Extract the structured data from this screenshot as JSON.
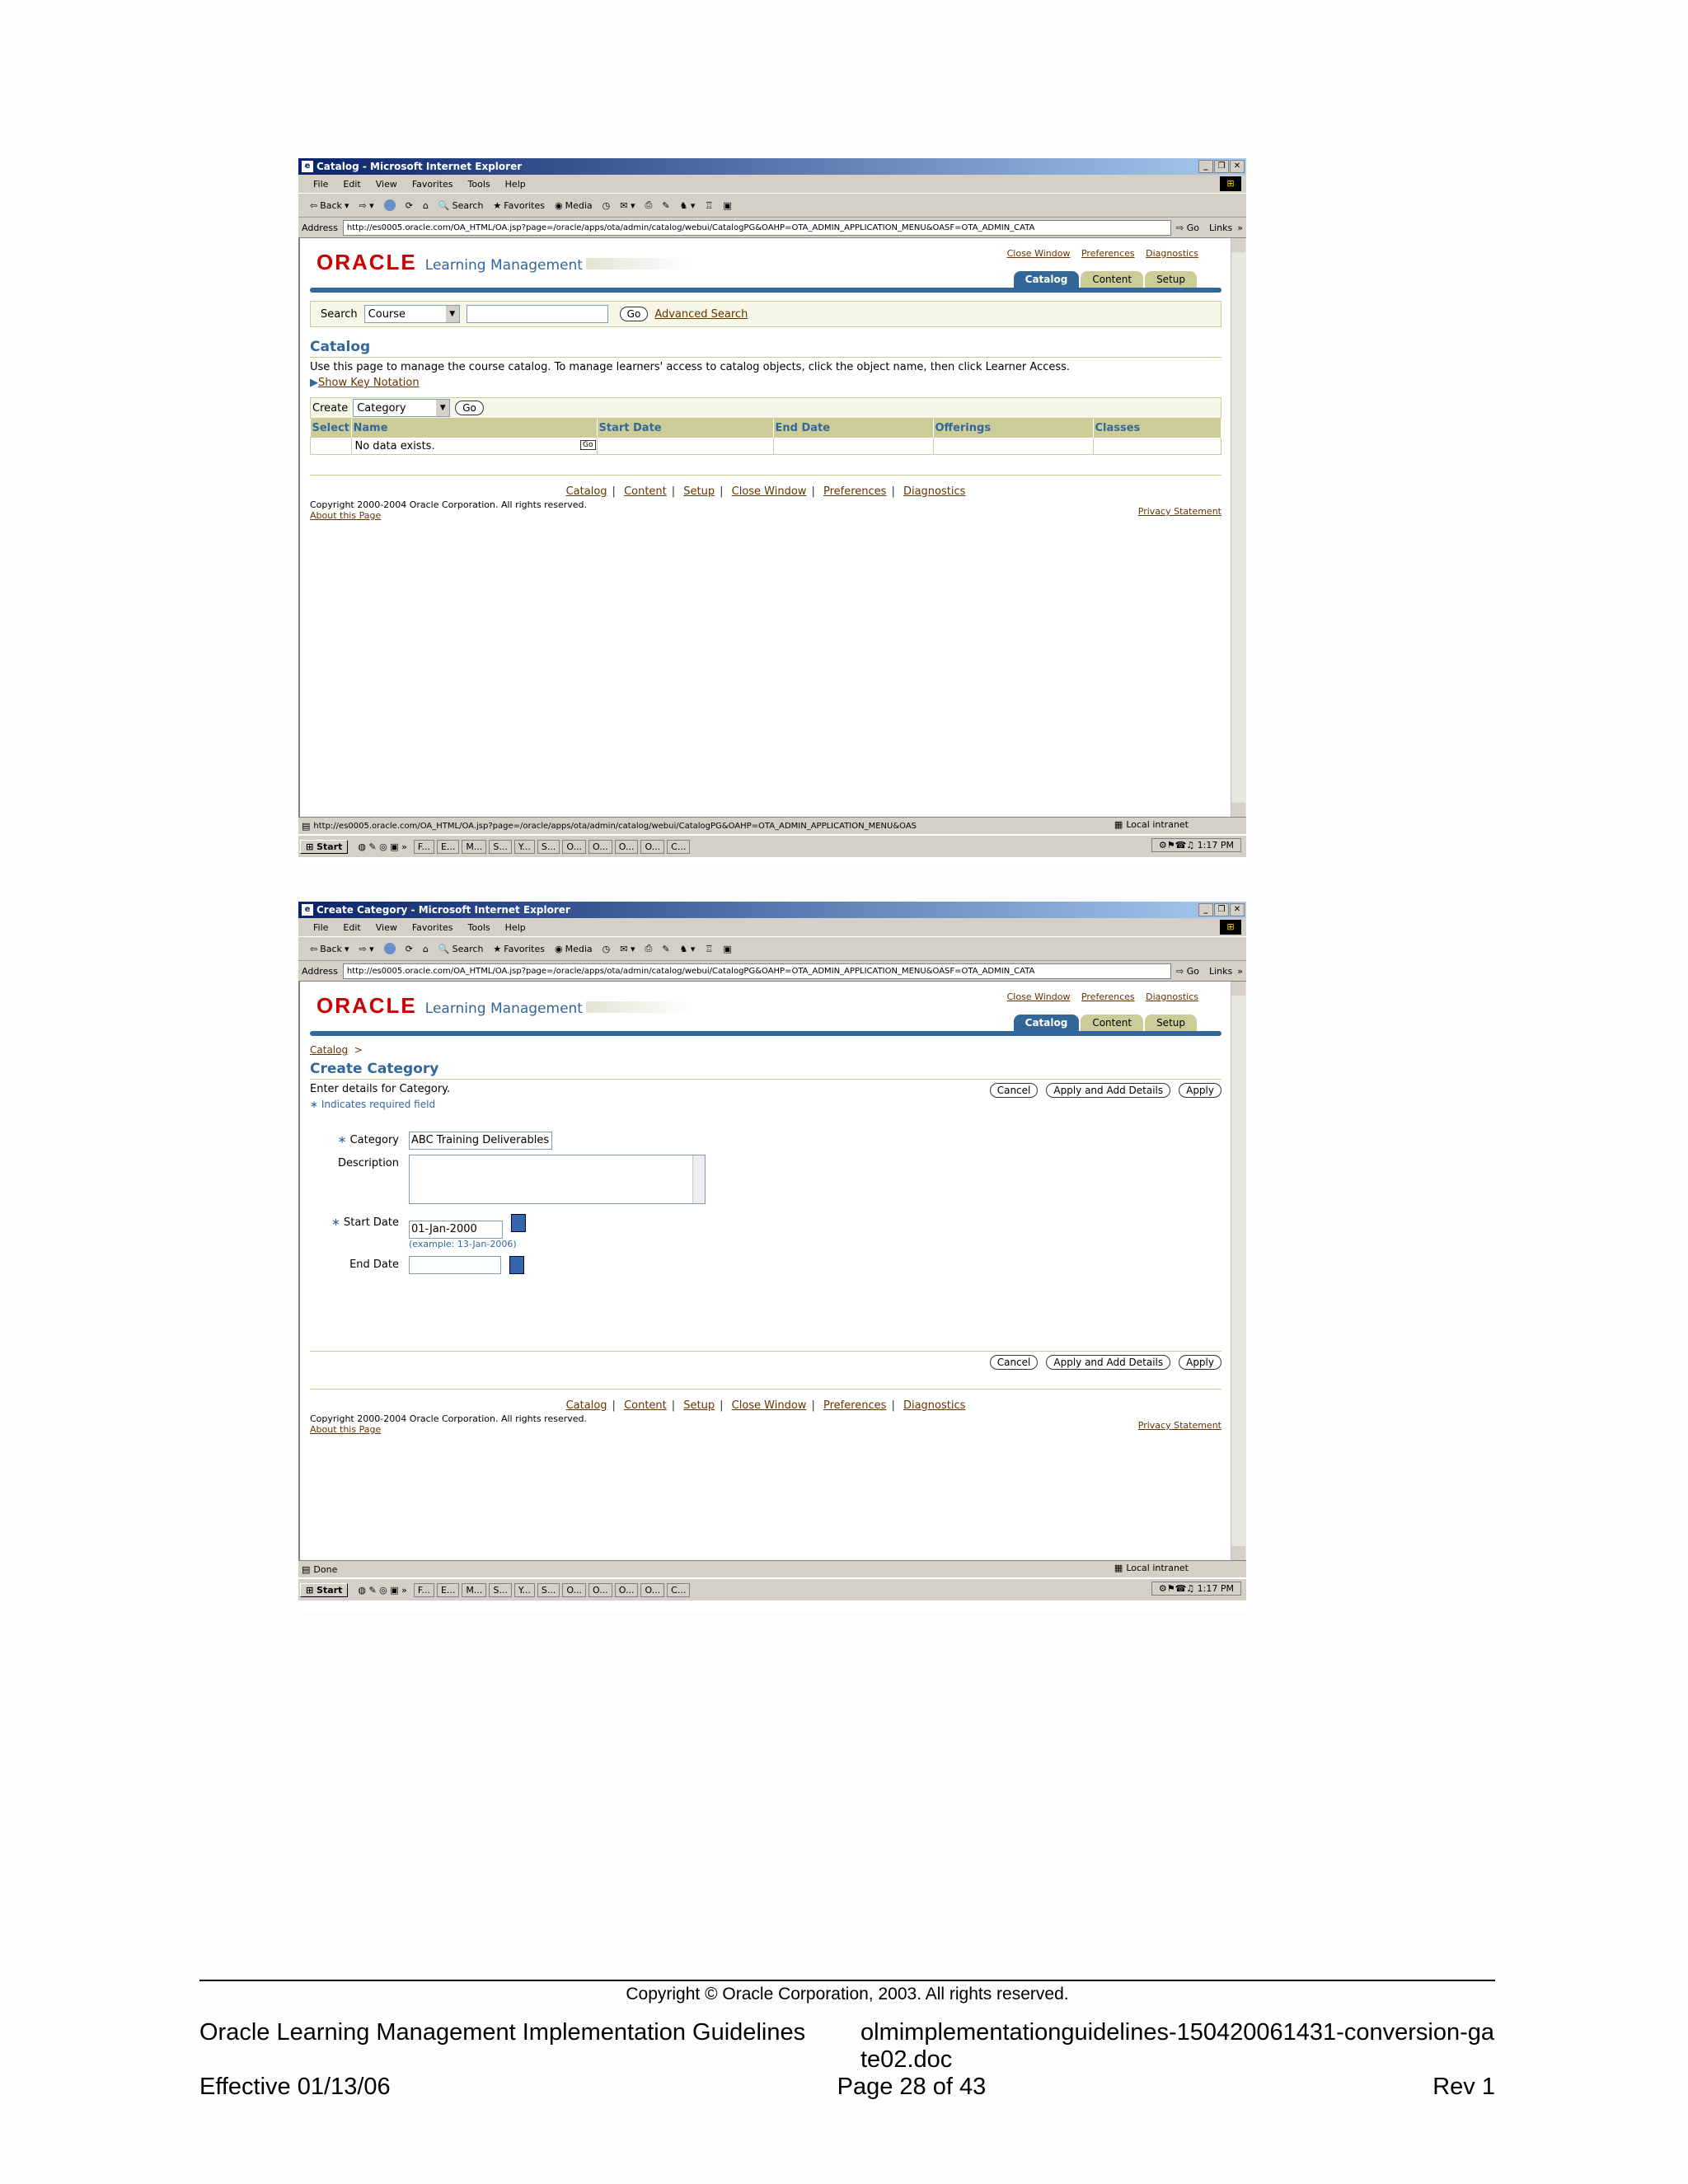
{
  "shot1": {
    "window_title": "Catalog - Microsoft Internet Explorer",
    "menu": [
      "File",
      "Edit",
      "View",
      "Favorites",
      "Tools",
      "Help"
    ],
    "toolbar": {
      "back": "Back",
      "search": "Search",
      "favorites": "Favorites",
      "media": "Media"
    },
    "address_label": "Address",
    "address_url": "http://es0005.oracle.com/OA_HTML/OA.jsp?page=/oracle/apps/ota/admin/catalog/webui/CatalogPG&OAHP=OTA_ADMIN_APPLICATION_MENU&OASF=OTA_ADMIN_CATA",
    "go": "Go",
    "links": "Links",
    "brand": "ORACLE",
    "product": "Learning Management",
    "global_links": [
      "Close Window",
      "Preferences",
      "Diagnostics"
    ],
    "tabs": [
      "Catalog",
      "Content",
      "Setup"
    ],
    "search_label": "Search",
    "search_select": "Course",
    "search_go": "Go",
    "advanced_search": "Advanced Search",
    "heading": "Catalog",
    "instructions": "Use this page to manage the course catalog. To manage learners' access to catalog objects, click the object name, then click Learner Access.",
    "show_key": "Show Key Notation",
    "create_label": "Create",
    "create_select": "Category",
    "create_go": "Go",
    "columns": [
      "Select",
      "Name",
      "Start Date",
      "End Date",
      "Offerings",
      "Classes"
    ],
    "no_data": "No data exists.",
    "footer_links": [
      "Catalog",
      "Content",
      "Setup",
      "Close Window",
      "Preferences",
      "Diagnostics"
    ],
    "copyright": "Copyright 2000-2004 Oracle Corporation. All rights reserved.",
    "about": "About this Page",
    "privacy": "Privacy Statement",
    "status_url": "http://es0005.oracle.com/OA_HTML/OA.jsp?page=/oracle/apps/ota/admin/catalog/webui/CatalogPG&OAHP=OTA_ADMIN_APPLICATION_MENU&OAS",
    "zone": "Local intranet",
    "start": "Start",
    "tasks": [
      "F...",
      "E...",
      "M...",
      "S...",
      "Y...",
      "S...",
      "O...",
      "O...",
      "O...",
      "O...",
      "C..."
    ],
    "clock": "1:17 PM"
  },
  "shot2": {
    "window_title": "Create Category - Microsoft Internet Explorer",
    "breadcrumb": "Catalog",
    "heading": "Create Category",
    "instructions": "Enter details for Category.",
    "required_note": "Indicates required field",
    "buttons": [
      "Cancel",
      "Apply and Add Details",
      "Apply"
    ],
    "category_label": "Category",
    "category_value": "ABC Training Deliverables",
    "description_label": "Description",
    "start_date_label": "Start Date",
    "start_date_value": "01-Jan-2000",
    "date_example": "(example: 13-Jan-2006)",
    "end_date_label": "End Date",
    "status": "Done",
    "zone": "Local intranet",
    "clock": "1:17 PM"
  },
  "doc_footer": {
    "copyright": "Copyright © Oracle Corporation, 2003. All rights reserved.",
    "title": "Oracle Learning Management Implementation Guidelines",
    "filename": "olmimplementationguidelines-150420061431-conversion-gate02.doc",
    "effective": "Effective 01/13/06",
    "page": "Page 28 of  43",
    "rev": "Rev 1"
  }
}
